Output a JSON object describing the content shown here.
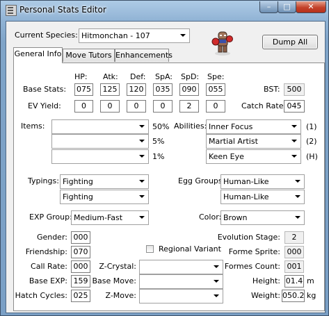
{
  "window": {
    "title": "Personal Stats Editor"
  },
  "species": {
    "label": "Current Species:",
    "value": "Hitmonchan - 107"
  },
  "dump_all": "Dump All",
  "tabs": [
    "General Info",
    "Move Tutors",
    "Enhancements"
  ],
  "stats": {
    "headers": [
      "HP:",
      "Atk:",
      "Def:",
      "SpA:",
      "SpD:",
      "Spe:"
    ],
    "base_label": "Base Stats:",
    "base": [
      "075",
      "125",
      "120",
      "035",
      "090",
      "055"
    ],
    "ev_label": "EV Yield:",
    "ev": [
      "0",
      "0",
      "0",
      "0",
      "2",
      "0"
    ],
    "bst_label": "BST:",
    "bst": "500",
    "catch_label": "Catch Rate:",
    "catch": "045"
  },
  "items": {
    "label": "Items:",
    "values": [
      "",
      "",
      ""
    ],
    "percents": [
      "50%",
      "5%",
      "1%"
    ]
  },
  "abilities": {
    "label": "Abilities:",
    "values": [
      "Inner Focus",
      "Martial Artist",
      "Keen Eye"
    ],
    "slots": [
      "(1)",
      "(2)",
      "(H)"
    ]
  },
  "typings": {
    "label": "Typings:",
    "values": [
      "Fighting",
      "Fighting"
    ]
  },
  "egg_groups": {
    "label": "Egg Groups:",
    "values": [
      "Human-Like",
      "Human-Like"
    ]
  },
  "exp_group": {
    "label": "EXP Group:",
    "value": "Medium-Fast"
  },
  "color": {
    "label": "Color:",
    "value": "Brown"
  },
  "left_fields": {
    "gender_label": "Gender:",
    "gender": "000",
    "friendship_label": "Friendship:",
    "friendship": "070",
    "call_rate_label": "Call Rate:",
    "call_rate": "000",
    "base_exp_label": "Base EXP:",
    "base_exp": "159",
    "hatch_label": "Hatch Cycles:",
    "hatch": "025"
  },
  "regional_variant": {
    "label": "Regional Variant",
    "checked": false
  },
  "z_crystal": {
    "label": "Z-Crystal:",
    "value": ""
  },
  "base_move": {
    "label": "Base Move:",
    "value": ""
  },
  "z_move": {
    "label": "Z-Move:",
    "value": ""
  },
  "right_fields": {
    "evo_label": "Evolution Stage:",
    "evo": "2",
    "forme_sprite_label": "Forme Sprite:",
    "forme_sprite": "000",
    "formes_count_label": "Formes Count:",
    "formes_count": "001",
    "height_label": "Height:",
    "height": "01.4",
    "height_unit": "m",
    "weight_label": "Weight:",
    "weight": "050.2",
    "weight_unit": "kg"
  },
  "colors": {
    "close": "#c3422a",
    "title_bg": "#8fb2d4",
    "client_bg": "#f0f0f0"
  }
}
